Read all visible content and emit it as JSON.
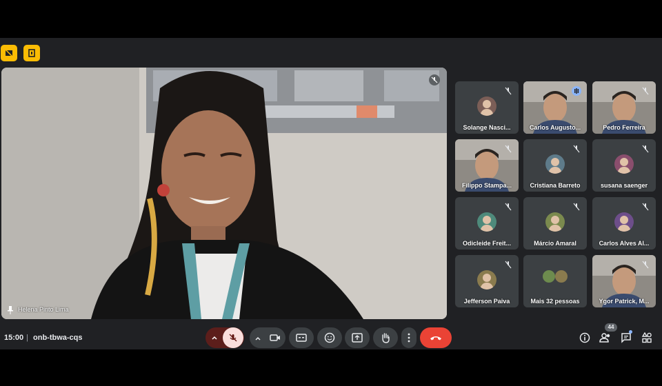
{
  "meeting": {
    "time": "15:00",
    "separator": "|",
    "code": "onb-tbwa-cqs",
    "participant_count": "44"
  },
  "main_speaker": {
    "name": "Helena Pinto Lima"
  },
  "participants": [
    {
      "name": "Solange Nasci...",
      "video": false,
      "speaking": false
    },
    {
      "name": "Carlos Augusto...",
      "video": true,
      "speaking": true
    },
    {
      "name": "Pedro Ferreira",
      "video": true,
      "speaking": false
    },
    {
      "name": "Filippo Stampa...",
      "video": true,
      "speaking": false
    },
    {
      "name": "Cristiana Barreto",
      "video": false,
      "speaking": false
    },
    {
      "name": "susana saenger",
      "video": false,
      "speaking": false
    },
    {
      "name": "Odicleide Freit...",
      "video": false,
      "speaking": false
    },
    {
      "name": "Márcio Amaral",
      "video": false,
      "speaking": false
    },
    {
      "name": "Carlos Alves Al...",
      "video": false,
      "speaking": false
    },
    {
      "name": "Jefferson Paiva",
      "video": false,
      "speaking": false
    },
    {
      "name": "Mais 32 pessoas",
      "video": false,
      "speaking": false
    },
    {
      "name": "Ygor Patrick, M...",
      "video": true,
      "speaking": false
    }
  ],
  "colors": {
    "background": "#202124",
    "tile": "#3c4043",
    "hangup": "#ea4335",
    "mic_off": "#f9dedc",
    "accent": "#8ab4f8",
    "warning": "#fbbc04"
  },
  "icons": {
    "top": [
      "shield-icon",
      "door-icon"
    ],
    "controls": [
      "chevron-up-icon",
      "mic-off-icon",
      "chevron-up-icon",
      "camera-icon",
      "captions-icon",
      "emoji-icon",
      "present-icon",
      "raise-hand-icon",
      "more-icon",
      "hangup-icon"
    ],
    "right": [
      "info-icon",
      "people-icon",
      "chat-icon",
      "activities-icon"
    ]
  }
}
